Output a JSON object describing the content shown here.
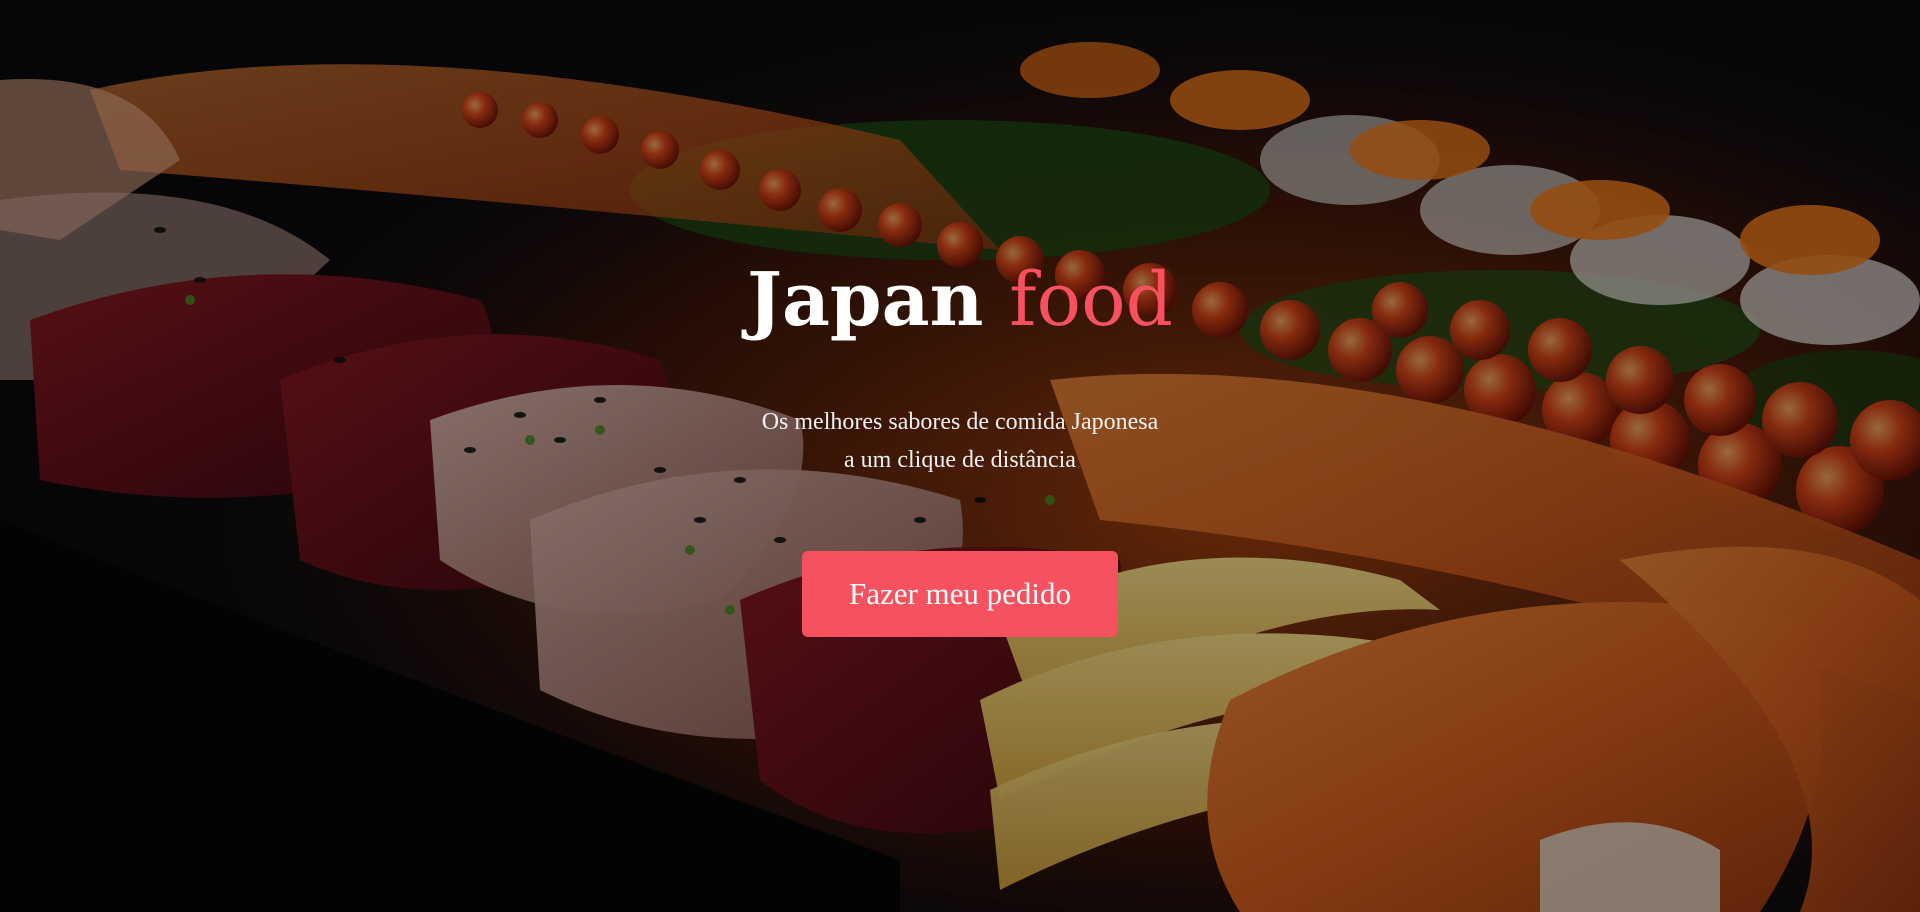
{
  "hero": {
    "title_main": "Japan",
    "title_accent": "food",
    "subtitle_line1": "Os melhores sabores de comida Japonesa",
    "subtitle_line2": "a um clique de distância",
    "cta_label": "Fazer meu pedido",
    "background_image": "sushi platter (nigiri, salmon roe, tamago) on dark tray"
  },
  "colors": {
    "accent": "#f5515f",
    "text": "#ffffff",
    "background": "#0b0b0e"
  }
}
